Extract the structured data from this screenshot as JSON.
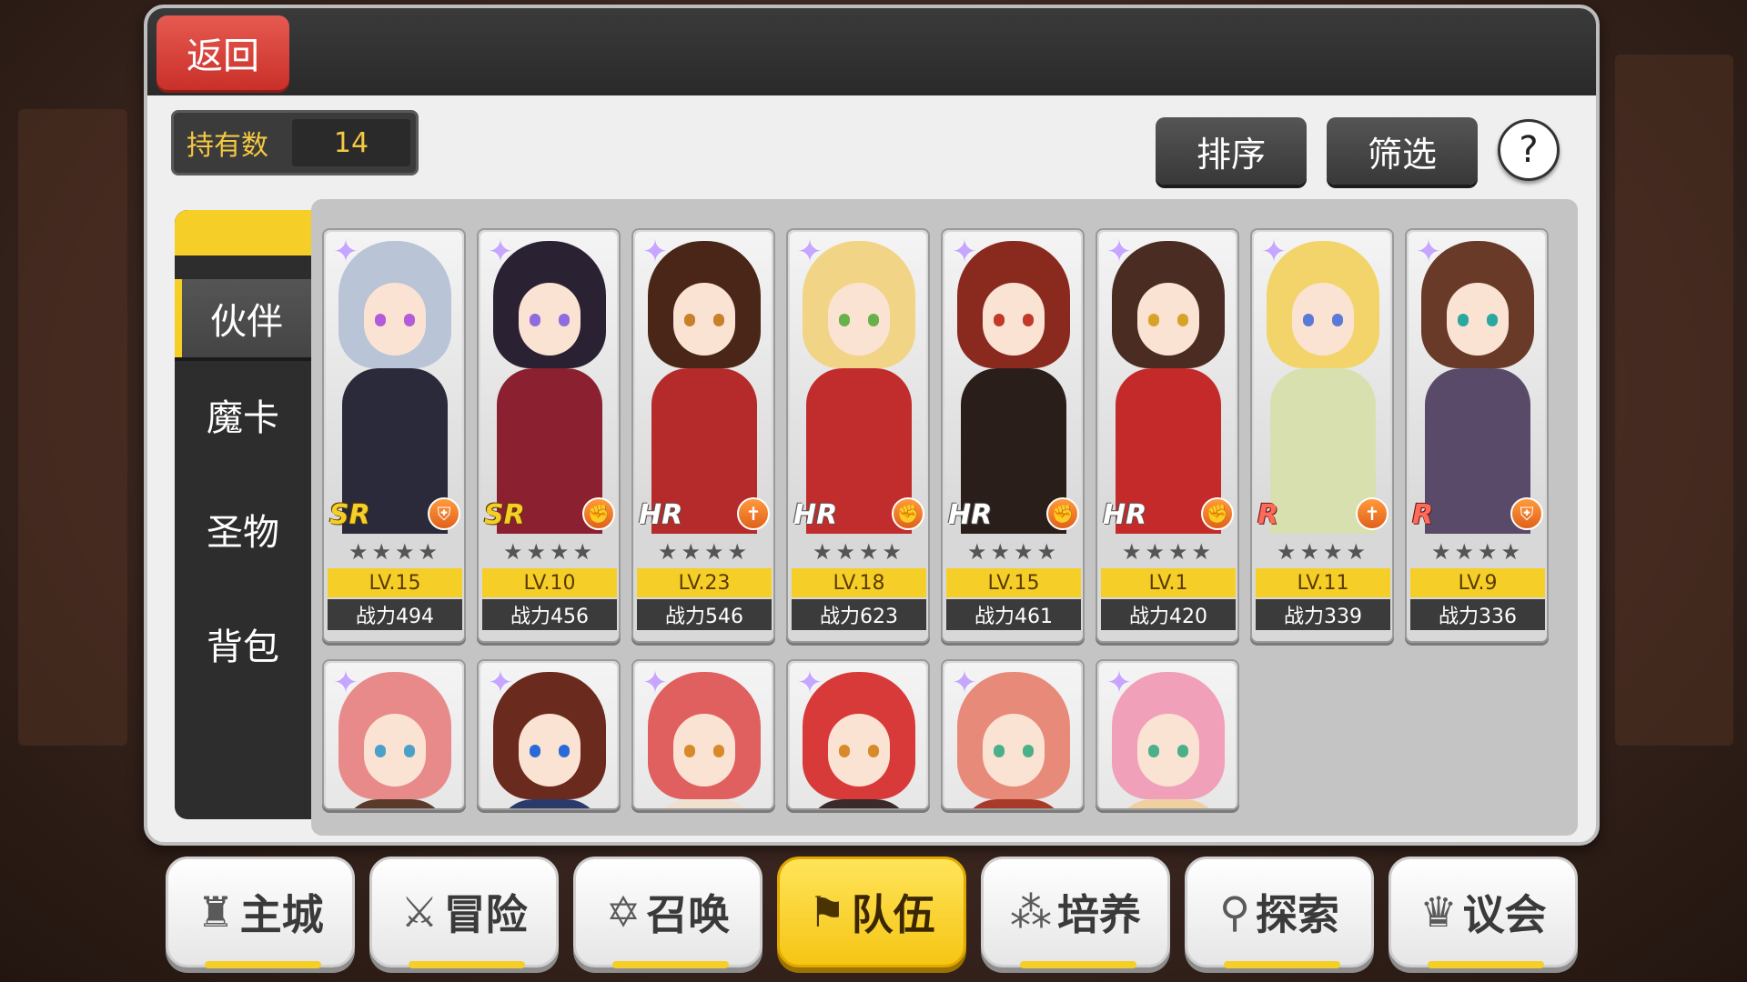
{
  "header": {
    "back_label": "返回"
  },
  "owned": {
    "label": "持有数",
    "value": "14"
  },
  "toolbar": {
    "sort_label": "排序",
    "filter_label": "筛选",
    "help_label": "?"
  },
  "side_tabs": [
    {
      "label": "伙伴",
      "active": true
    },
    {
      "label": "魔卡",
      "active": false
    },
    {
      "label": "圣物",
      "active": false
    },
    {
      "label": "背包",
      "active": false
    }
  ],
  "cards": [
    {
      "rarity": "SR",
      "stars": "★★★★",
      "level": "LV.15",
      "power": "战力494",
      "class_icon": "shield-icon",
      "hair": "#b9c4d6",
      "outfit": "#2a2a3a",
      "eye": "#b35bd8"
    },
    {
      "rarity": "SR",
      "stars": "★★★★",
      "level": "LV.10",
      "power": "战力456",
      "class_icon": "fist-icon",
      "hair": "#2a2233",
      "outfit": "#8a2030",
      "eye": "#8f6be0"
    },
    {
      "rarity": "HR",
      "stars": "★★★★",
      "level": "LV.23",
      "power": "战力546",
      "class_icon": "cross-icon",
      "hair": "#4a2618",
      "outfit": "#b52a2a",
      "eye": "#c8802a"
    },
    {
      "rarity": "HR",
      "stars": "★★★★",
      "level": "LV.18",
      "power": "战力623",
      "class_icon": "fist-icon",
      "hair": "#f2d486",
      "outfit": "#c12c2c",
      "eye": "#6ab04a"
    },
    {
      "rarity": "HR",
      "stars": "★★★★",
      "level": "LV.15",
      "power": "战力461",
      "class_icon": "fist-icon",
      "hair": "#8a2a1e",
      "outfit": "#2a1e1a",
      "eye": "#c2392a"
    },
    {
      "rarity": "HR",
      "stars": "★★★★",
      "level": "LV.1",
      "power": "战力420",
      "class_icon": "fist-icon",
      "hair": "#4a2c22",
      "outfit": "#c42a2a",
      "eye": "#d8a22a"
    },
    {
      "rarity": "R",
      "stars": "★★★★",
      "level": "LV.11",
      "power": "战力339",
      "class_icon": "cross-icon",
      "hair": "#f2d46a",
      "outfit": "#d8e0b0",
      "eye": "#5a7ad8"
    },
    {
      "rarity": "R",
      "stars": "★★★★",
      "level": "LV.9",
      "power": "战力336",
      "class_icon": "shield-icon",
      "hair": "#6a3a28",
      "outfit": "#5a4a6a",
      "eye": "#2aa8a0"
    }
  ],
  "cards_row2": [
    {
      "hair": "#e88a8a",
      "outfit": "#5a3a2a",
      "eye": "#4aa0c8"
    },
    {
      "hair": "#6a2a1e",
      "outfit": "#2a3a6a",
      "eye": "#2a6ad8"
    },
    {
      "hair": "#e06060",
      "outfit": "#f0e0d0",
      "eye": "#d88a2a"
    },
    {
      "hair": "#d83a3a",
      "outfit": "#3a2a2a",
      "eye": "#d88a2a"
    },
    {
      "hair": "#e88a7a",
      "outfit": "#a83a2a",
      "eye": "#4ab08a"
    },
    {
      "hair": "#f0a0b8",
      "outfit": "#f0d0a0",
      "eye": "#4ab08a"
    }
  ],
  "bottom_nav": [
    {
      "label": "主城",
      "icon": "castle-icon",
      "glyph": "♜",
      "active": false
    },
    {
      "label": "冒险",
      "icon": "crossed-swords-icon",
      "glyph": "⚔",
      "active": false
    },
    {
      "label": "召唤",
      "icon": "hexagram-icon",
      "glyph": "✡",
      "active": false
    },
    {
      "label": "队伍",
      "icon": "party-icon",
      "glyph": "⚑",
      "active": true
    },
    {
      "label": "培养",
      "icon": "circles-icon",
      "glyph": "⁂",
      "active": false
    },
    {
      "label": "探索",
      "icon": "explore-icon",
      "glyph": "⚲",
      "active": false
    },
    {
      "label": "议会",
      "icon": "council-icon",
      "glyph": "♛",
      "active": false
    }
  ]
}
